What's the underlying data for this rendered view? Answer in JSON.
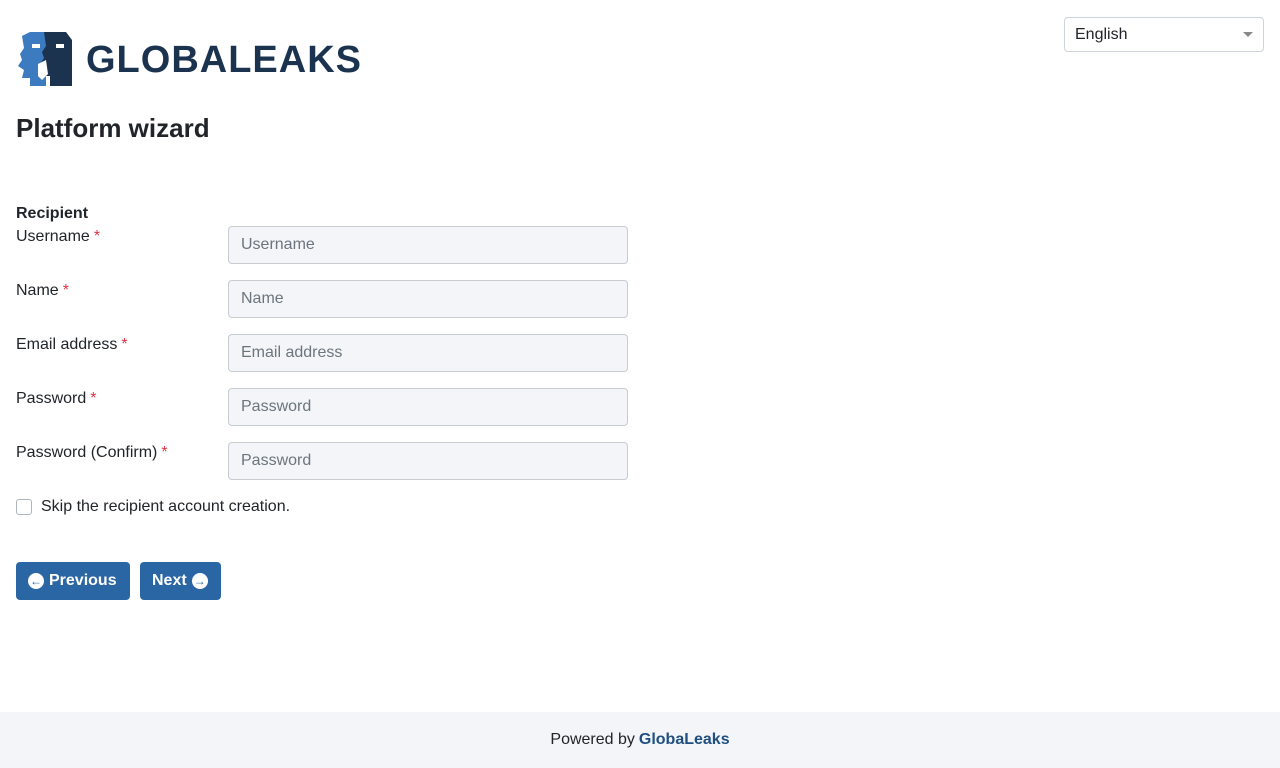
{
  "header": {
    "logo_text": "GLOBALEAKS",
    "language": {
      "selected": "English"
    }
  },
  "page": {
    "title": "Platform wizard",
    "section_label": "Recipient"
  },
  "form": {
    "fields": [
      {
        "label": "Username",
        "required_mark": "*",
        "placeholder": "Username",
        "value": ""
      },
      {
        "label": "Name",
        "required_mark": "*",
        "placeholder": "Name",
        "value": ""
      },
      {
        "label": "Email address",
        "required_mark": "*",
        "placeholder": "Email address",
        "value": ""
      },
      {
        "label": "Password",
        "required_mark": "*",
        "placeholder": "Password",
        "value": ""
      },
      {
        "label": "Password (Confirm)",
        "required_mark": "*",
        "placeholder": "Password",
        "value": ""
      }
    ],
    "skip_checkbox": {
      "label": "Skip the recipient account creation.",
      "checked": false
    }
  },
  "buttons": {
    "previous": {
      "label": "Previous",
      "icon": "arrow-left-circle-icon"
    },
    "next": {
      "label": "Next",
      "icon": "arrow-right-circle-icon"
    }
  },
  "footer": {
    "prefix": "Powered by",
    "link": "GlobaLeaks"
  },
  "colors": {
    "primary": "#2a66a3",
    "logo": "#1c3350",
    "logo_accent": "#3c7bc0",
    "required": "#dc3545",
    "footer_bg": "#f3f5f8"
  }
}
